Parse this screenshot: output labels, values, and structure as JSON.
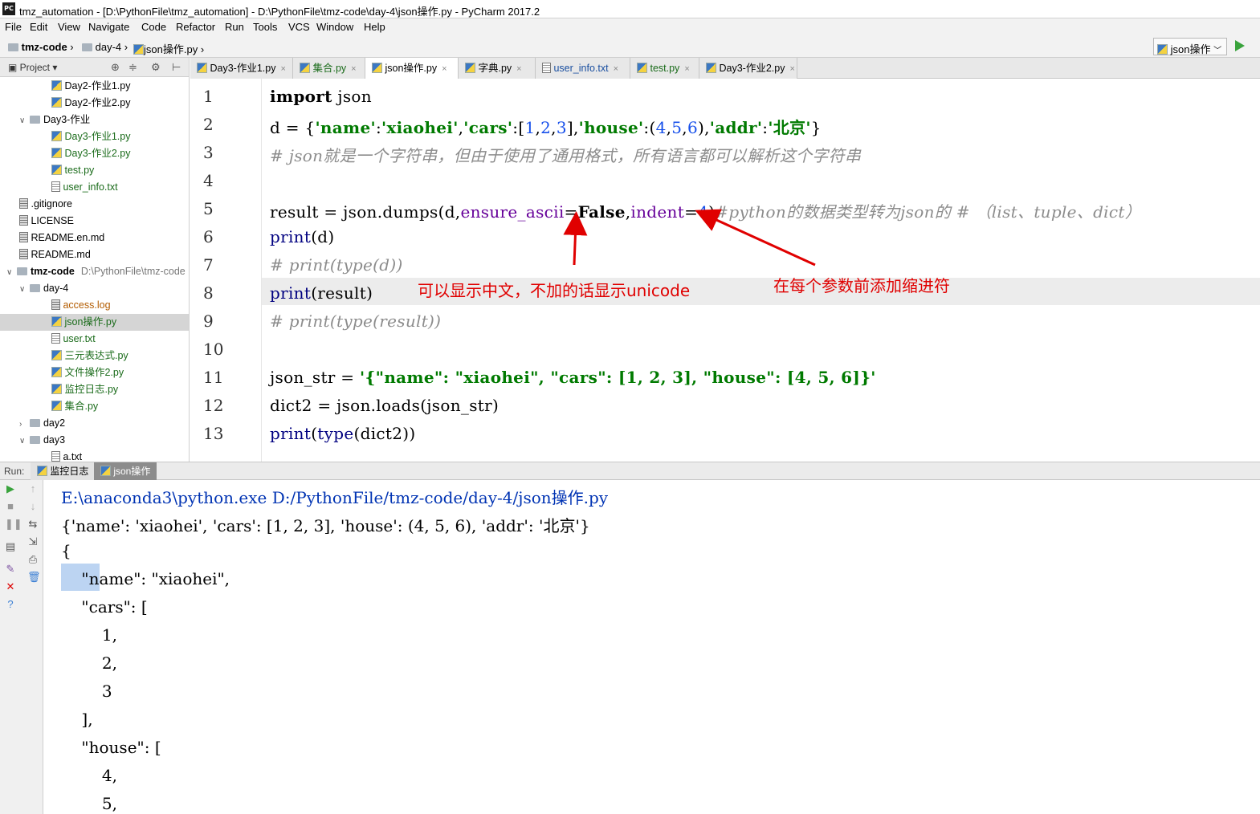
{
  "window": {
    "title": "tmz_automation - [D:\\PythonFile\\tmz_automation] - D:\\PythonFile\\tmz-code\\day-4\\json操作.py - PyCharm 2017.2",
    "app_icon": "PC"
  },
  "menu": [
    "File",
    "Edit",
    "View",
    "Navigate",
    "Code",
    "Refactor",
    "Run",
    "Tools",
    "VCS",
    "Window",
    "Help"
  ],
  "breadcrumb": [
    "tmz-code",
    "day-4",
    "json操作.py"
  ],
  "run_config": {
    "label": "json操作"
  },
  "project_panel": {
    "title": "Project",
    "rows": [
      {
        "label": "Day2-作业1.py",
        "icon": "python-file-icon",
        "indent": 2
      },
      {
        "label": "Day2-作业2.py",
        "icon": "python-file-icon",
        "indent": 2
      },
      {
        "label": "Day3-作业",
        "icon": "folder-icon",
        "indent": 1,
        "expanded": true
      },
      {
        "label": "Day3-作业1.py",
        "icon": "python-file-icon",
        "indent": 2
      },
      {
        "label": "Day3-作业2.py",
        "icon": "python-file-icon",
        "indent": 2
      },
      {
        "label": "test.py",
        "icon": "python-file-icon",
        "indent": 2
      },
      {
        "label": "user_info.txt",
        "icon": "text-file-icon",
        "indent": 2
      },
      {
        "label": ".gitignore",
        "icon": "file-icon",
        "indent": 1
      },
      {
        "label": "LICENSE",
        "icon": "file-icon",
        "indent": 1
      },
      {
        "label": "README.en.md",
        "icon": "file-icon",
        "indent": 1
      },
      {
        "label": "README.md",
        "icon": "file-icon",
        "indent": 1
      },
      {
        "label": "tmz-code",
        "icon": "folder-icon",
        "indent": 0,
        "expanded": true,
        "hint": "D:\\PythonFile\\tmz-code"
      },
      {
        "label": "day-4",
        "icon": "folder-icon",
        "indent": 1,
        "expanded": true
      },
      {
        "label": "access.log",
        "icon": "file-icon",
        "indent": 2
      },
      {
        "label": "json操作.py",
        "icon": "python-file-icon",
        "indent": 2,
        "selected": true
      },
      {
        "label": "user.txt",
        "icon": "text-file-icon",
        "indent": 2
      },
      {
        "label": "三元表达式.py",
        "icon": "python-file-icon",
        "indent": 2
      },
      {
        "label": "文件操作2.py",
        "icon": "python-file-icon",
        "indent": 2
      },
      {
        "label": "监控日志.py",
        "icon": "python-file-icon",
        "indent": 2
      },
      {
        "label": "集合.py",
        "icon": "python-file-icon",
        "indent": 2
      },
      {
        "label": "day2",
        "icon": "folder-icon",
        "indent": 1,
        "expanded": false
      },
      {
        "label": "day3",
        "icon": "folder-icon",
        "indent": 1,
        "expanded": true
      },
      {
        "label": "a.txt",
        "icon": "text-file-icon",
        "indent": 2
      }
    ]
  },
  "tabs": [
    {
      "label": "Day3-作业1.py",
      "active": false
    },
    {
      "label": "集合.py",
      "active": false
    },
    {
      "label": "json操作.py",
      "active": true
    },
    {
      "label": "字典.py",
      "active": false
    },
    {
      "label": "user_info.txt",
      "active": false
    },
    {
      "label": "test.py",
      "active": false
    },
    {
      "label": "Day3-作业2.py",
      "active": false
    }
  ],
  "editor": {
    "line_numbers": [
      "1",
      "2",
      "3",
      "4",
      "5",
      "6",
      "7",
      "8",
      "9",
      "10",
      "11",
      "12",
      "13"
    ],
    "lines": [
      [
        {
          "t": "import",
          "c": "kw"
        },
        {
          "t": " json",
          "c": ""
        }
      ],
      [
        {
          "t": "d = {",
          "c": ""
        },
        {
          "t": "'name'",
          "c": "str"
        },
        {
          "t": ":",
          "c": ""
        },
        {
          "t": "'xiaohei'",
          "c": "str"
        },
        {
          "t": ",",
          "c": ""
        },
        {
          "t": "'cars'",
          "c": "str"
        },
        {
          "t": ":[",
          "c": ""
        },
        {
          "t": "1",
          "c": "num"
        },
        {
          "t": ",",
          "c": ""
        },
        {
          "t": "2",
          "c": "num"
        },
        {
          "t": ",",
          "c": ""
        },
        {
          "t": "3",
          "c": "num"
        },
        {
          "t": "],",
          "c": ""
        },
        {
          "t": "'house'",
          "c": "str"
        },
        {
          "t": ":(",
          "c": ""
        },
        {
          "t": "4",
          "c": "num"
        },
        {
          "t": ",",
          "c": ""
        },
        {
          "t": "5",
          "c": "num"
        },
        {
          "t": ",",
          "c": ""
        },
        {
          "t": "6",
          "c": "num"
        },
        {
          "t": "),",
          "c": ""
        },
        {
          "t": "'addr'",
          "c": "str"
        },
        {
          "t": ":",
          "c": ""
        },
        {
          "t": "'北京'",
          "c": "str"
        },
        {
          "t": "}",
          "c": ""
        }
      ],
      [
        {
          "t": "# json就是一个字符串，但由于使用了通用格式，所有语言都可以解析这个字符串",
          "c": "cmt"
        }
      ],
      [],
      [
        {
          "t": "result = json.dumps(d,",
          "c": ""
        },
        {
          "t": "ensure_ascii",
          "c": "param"
        },
        {
          "t": "=",
          "c": ""
        },
        {
          "t": "False",
          "c": "kw"
        },
        {
          "t": ",",
          "c": ""
        },
        {
          "t": "indent",
          "c": "param"
        },
        {
          "t": "=",
          "c": ""
        },
        {
          "t": "4",
          "c": "num"
        },
        {
          "t": ")",
          "c": ""
        },
        {
          "t": "#python的数据类型转为json的 # （list、tuple、dict）",
          "c": "cmt"
        }
      ],
      [
        {
          "t": "print",
          "c": "builtin"
        },
        {
          "t": "(d)",
          "c": ""
        }
      ],
      [
        {
          "t": "# print(type(d))",
          "c": "cmt"
        }
      ],
      [
        {
          "t": "print",
          "c": "builtin"
        },
        {
          "t": "(result)",
          "c": ""
        }
      ],
      [
        {
          "t": "# print(type(result))",
          "c": "cmt"
        }
      ],
      [],
      [
        {
          "t": "json_str = ",
          "c": ""
        },
        {
          "t": "'{\"name\": \"xiaohei\", \"cars\": [1, 2, 3], \"house\": [4, 5, 6]}'",
          "c": "str"
        }
      ],
      [
        {
          "t": "dict2 = json.loads(json_str)",
          "c": ""
        }
      ],
      [
        {
          "t": "print",
          "c": "builtin"
        },
        {
          "t": "(",
          "c": ""
        },
        {
          "t": "type",
          "c": "builtin"
        },
        {
          "t": "(dict2))",
          "c": ""
        }
      ]
    ],
    "annotations": {
      "ensure_ascii_note": "可以显示中文，不加的话显示unicode",
      "indent_note": "在每个参数前添加缩进符"
    }
  },
  "run_panel": {
    "label": "Run:",
    "tabs": [
      {
        "label": "监控日志",
        "active": false
      },
      {
        "label": "json操作",
        "active": true
      }
    ],
    "output": [
      "E:\\anaconda3\\python.exe D:/PythonFile/tmz-code/day-4/json操作.py",
      "{'name': 'xiaohei', 'cars': [1, 2, 3], 'house': (4, 5, 6), 'addr': '北京'}",
      "{",
      "    \"name\": \"xiaohei\",",
      "    \"cars\": [",
      "        1,",
      "        2,",
      "        3",
      "    ],",
      "    \"house\": [",
      "        4,",
      "        5,"
    ]
  },
  "colors": {
    "keyword": "#000000",
    "string": "#007a00",
    "number": "#1750eb",
    "comment": "#8c8c8c",
    "param": "#660099",
    "annotation": "#e00000",
    "selection": "#bcd4f2"
  }
}
